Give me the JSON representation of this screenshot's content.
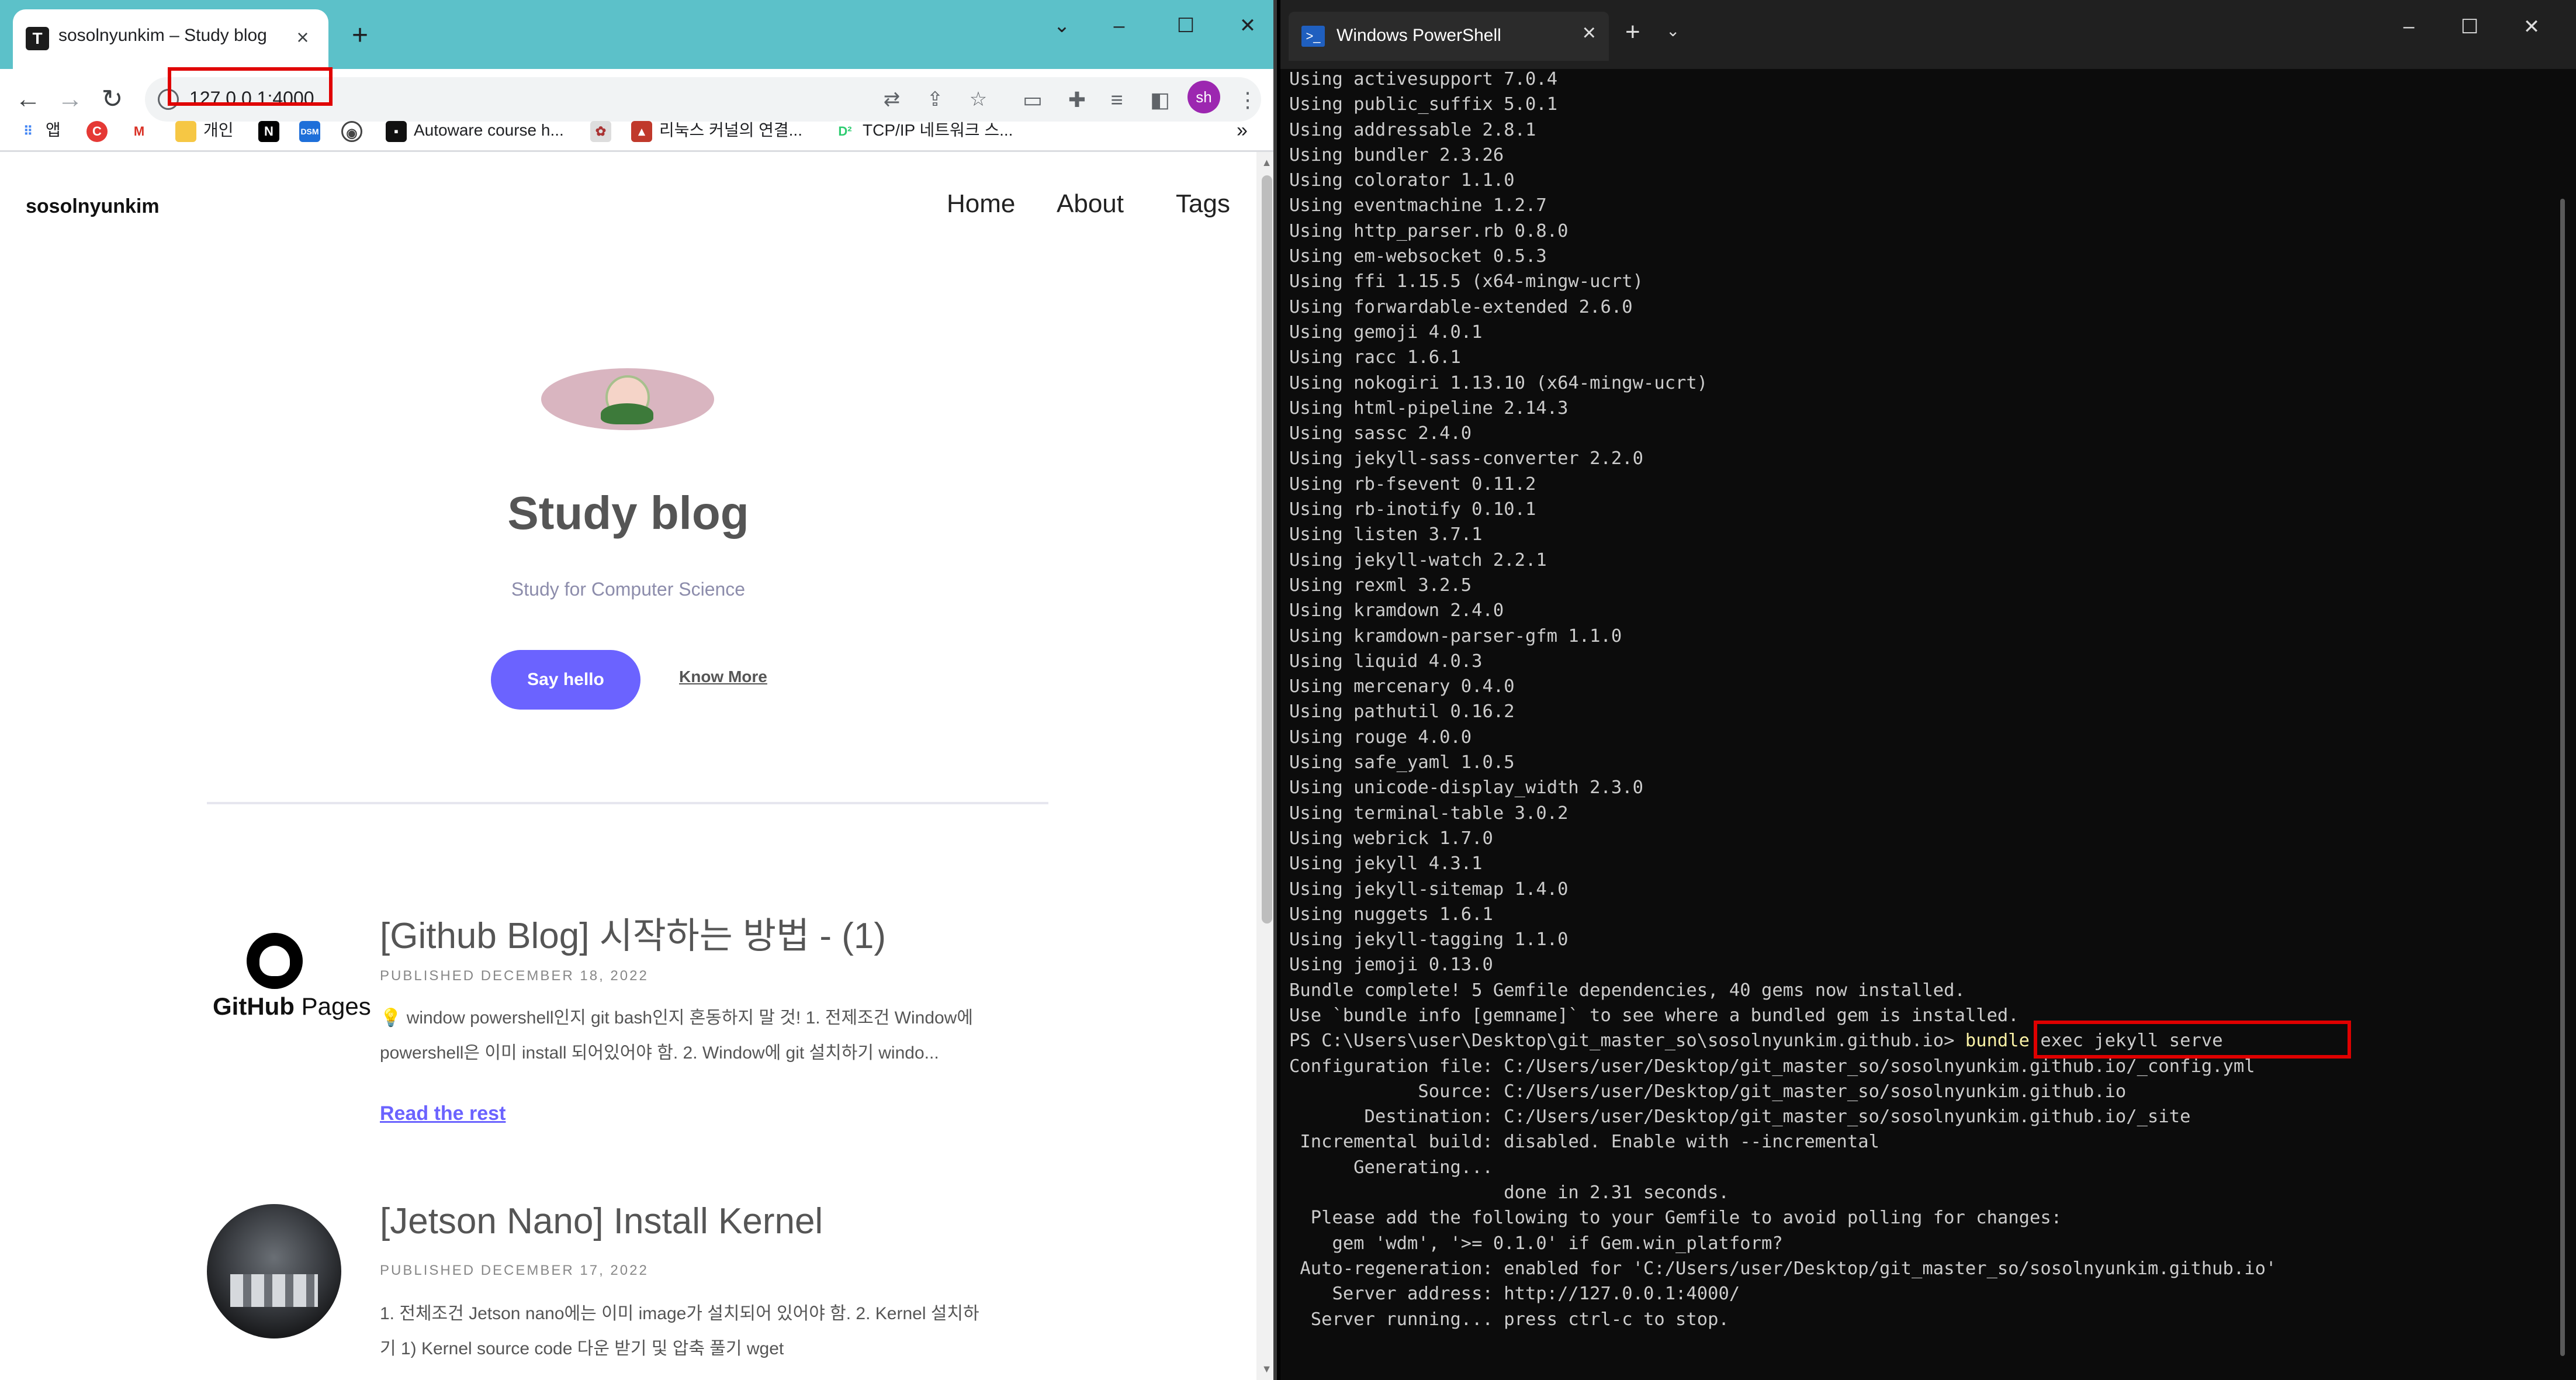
{
  "browser": {
    "tab_title": "sosolnyunkim – Study blog",
    "tab_favicon": "T",
    "url": "127.0.0.1:4000",
    "profile_initials": "sh",
    "bookmarks": [
      "앱",
      "개인",
      "Autoware course h...",
      "리눅스 커널의 연결...",
      "TCP/IP 네트워크 스..."
    ],
    "more_bookmarks": "»"
  },
  "site": {
    "title": "sosolnyunkim",
    "nav": [
      "Home",
      "About",
      "Tags"
    ],
    "hero_title": "Study blog",
    "hero_subtitle": "Study for Computer Science",
    "say_hello": "Say hello",
    "know_more": "Know More"
  },
  "posts": [
    {
      "title": "[Github Blog] 시작하는 방법 - (1)",
      "date": "PUBLISHED DECEMBER 18, 2022",
      "excerpt_line1": "💡 window powershell인지 git bash인지 혼동하지 말 것! 1. 전제조건 Window에",
      "excerpt_line2": "powershell은 이미 install 되어있어야 함. 2. Window에 git 설치하기 windo...",
      "read_more": "Read the rest",
      "thumb_text_bold": "GitHub",
      "thumb_text_light": " Pages"
    },
    {
      "title": "[Jetson Nano] Install Kernel",
      "date": "PUBLISHED DECEMBER 17, 2022",
      "excerpt_line1": "1. 전체조건 Jetson nano에는 이미 image가 설치되어 있어야 함. 2. Kernel 설치하",
      "excerpt_line2": "기 1) Kernel source code 다운 받기 및 압축 풀기 wget"
    }
  ],
  "powershell": {
    "tab_title": "Windows PowerShell",
    "lines_before": [
      "Using activesupport 7.0.4",
      "Using public_suffix 5.0.1",
      "Using addressable 2.8.1",
      "Using bundler 2.3.26",
      "Using colorator 1.1.0",
      "Using eventmachine 1.2.7",
      "Using http_parser.rb 0.8.0",
      "Using em-websocket 0.5.3",
      "Using ffi 1.15.5 (x64-mingw-ucrt)",
      "Using forwardable-extended 2.6.0",
      "Using gemoji 4.0.1",
      "Using racc 1.6.1",
      "Using nokogiri 1.13.10 (x64-mingw-ucrt)",
      "Using html-pipeline 2.14.3",
      "Using sassc 2.4.0",
      "Using jekyll-sass-converter 2.2.0",
      "Using rb-fsevent 0.11.2",
      "Using rb-inotify 0.10.1",
      "Using listen 3.7.1",
      "Using jekyll-watch 2.2.1",
      "Using rexml 3.2.5",
      "Using kramdown 2.4.0",
      "Using kramdown-parser-gfm 1.1.0",
      "Using liquid 4.0.3",
      "Using mercenary 0.4.0",
      "Using pathutil 0.16.2",
      "Using rouge 4.0.0",
      "Using safe_yaml 1.0.5",
      "Using unicode-display_width 2.3.0",
      "Using terminal-table 3.0.2",
      "Using webrick 1.7.0",
      "Using jekyll 4.3.1",
      "Using jekyll-sitemap 1.4.0",
      "Using nuggets 1.6.1",
      "Using jekyll-tagging 1.1.0",
      "Using jemoji 0.13.0",
      "Bundle complete! 5 Gemfile dependencies, 40 gems now installed.",
      "Use `bundle info [gemname]` to see where a bundled gem is installed."
    ],
    "prompt": "PS C:\\Users\\user\\Desktop\\git_master_so\\sosolnyunkim.github.io> ",
    "command_keyword": "bundle",
    "command_args": " exec jekyll serve",
    "lines_after": [
      "Configuration file: C:/Users/user/Desktop/git_master_so/sosolnyunkim.github.io/_config.yml",
      "            Source: C:/Users/user/Desktop/git_master_so/sosolnyunkim.github.io",
      "       Destination: C:/Users/user/Desktop/git_master_so/sosolnyunkim.github.io/_site",
      " Incremental build: disabled. Enable with --incremental",
      "      Generating...",
      "                    done in 2.31 seconds.",
      "  Please add the following to your Gemfile to avoid polling for changes:",
      "    gem 'wdm', '>= 0.1.0' if Gem.win_platform?",
      " Auto-regeneration: enabled for 'C:/Users/user/Desktop/git_master_so/sosolnyunkim.github.io'",
      "    Server address: http://127.0.0.1:4000/",
      "  Server running... press ctrl-c to stop."
    ]
  },
  "colors": {
    "tabstrip": "#5cc1c9",
    "accent_button": "#6b63ff",
    "highlight_box": "#e00000",
    "terminal_bg": "#0c0c0c",
    "terminal_text": "#cccccc",
    "command_yellow": "#f9f1a5"
  }
}
